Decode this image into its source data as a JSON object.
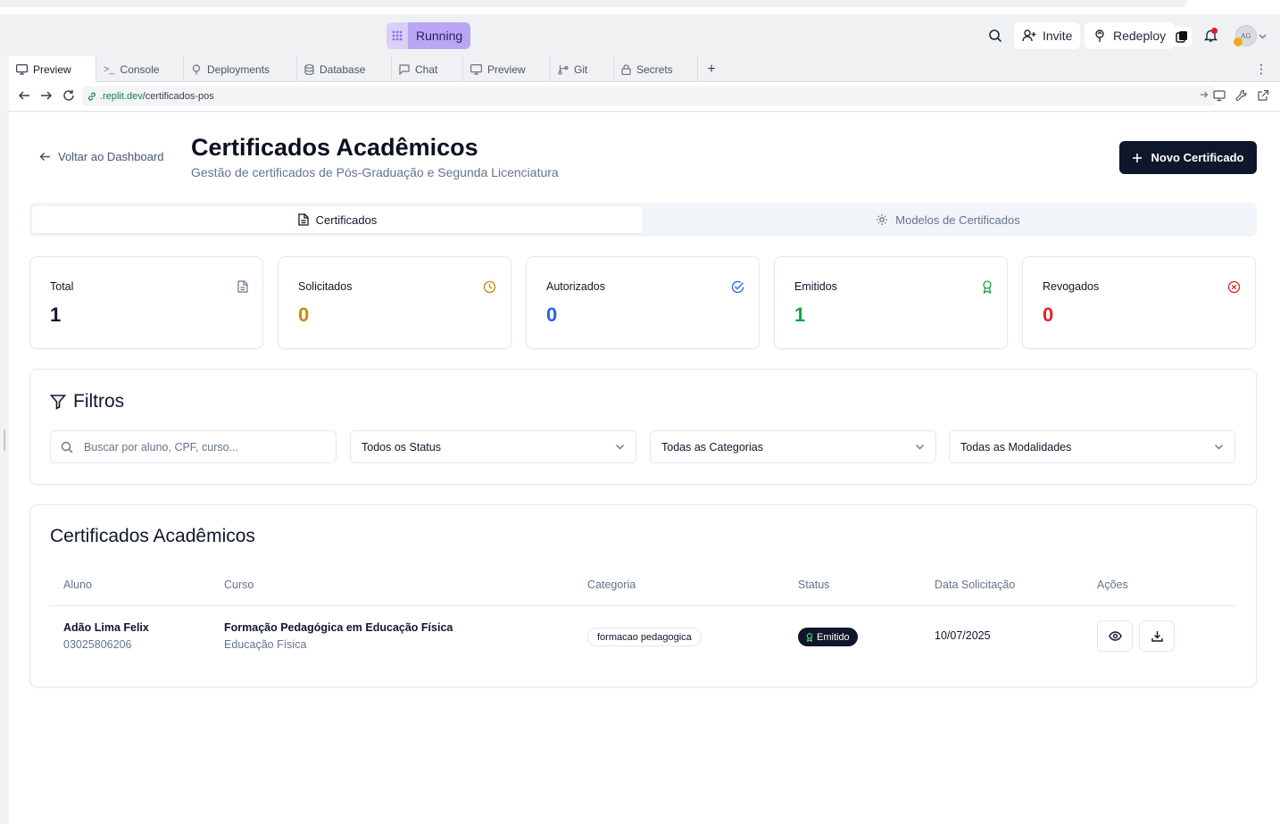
{
  "header": {
    "status": "Running",
    "invite_label": "Invite",
    "redeploy_label": "Redeploy",
    "avatar_initials": "AG"
  },
  "tabs": [
    {
      "label": "Preview",
      "icon": "monitor-icon"
    },
    {
      "label": "Console",
      "icon": "terminal-icon"
    },
    {
      "label": "Deployments",
      "icon": "deploy-icon"
    },
    {
      "label": "Database",
      "icon": "database-icon"
    },
    {
      "label": "Chat",
      "icon": "chat-icon"
    },
    {
      "label": "Preview",
      "icon": "monitor-icon"
    },
    {
      "label": "Git",
      "icon": "git-icon"
    },
    {
      "label": "Secrets",
      "icon": "lock-icon"
    }
  ],
  "url": {
    "domain": ".replit.dev",
    "path": "/certificados-pos"
  },
  "page": {
    "back_label": "Voltar ao Dashboard",
    "title": "Certificados Acadêmicos",
    "subtitle": "Gestão de certificados de Pós-Graduação e Segunda Licenciatura",
    "new_button": "Novo Certificado"
  },
  "segment": {
    "tab1": "Certificados",
    "tab2": "Modelos de Certificados"
  },
  "stats": [
    {
      "label": "Total",
      "value": "1",
      "color": "#0f172a",
      "icon": "document-icon"
    },
    {
      "label": "Solicitados",
      "value": "0",
      "color": "#ca8a04",
      "icon": "clock-icon"
    },
    {
      "label": "Autorizados",
      "value": "0",
      "color": "#2563eb",
      "icon": "check-circle-icon"
    },
    {
      "label": "Emitidos",
      "value": "1",
      "color": "#16a34a",
      "icon": "award-icon"
    },
    {
      "label": "Revogados",
      "value": "0",
      "color": "#dc2626",
      "icon": "x-circle-icon"
    }
  ],
  "filters": {
    "title": "Filtros",
    "search_placeholder": "Buscar por aluno, CPF, curso...",
    "status": "Todos os Status",
    "category": "Todas as Categorias",
    "modality": "Todas as Modalidades"
  },
  "table": {
    "title": "Certificados Acadêmicos",
    "headers": [
      "Aluno",
      "Curso",
      "Categoria",
      "Status",
      "Data Solicitação",
      "Ações"
    ],
    "rows": [
      {
        "student": "Adão Lima Felix",
        "cpf": "03025806206",
        "course": "Formação Pedagógica em Educação Física",
        "area": "Educação Física",
        "category": "formacao pedagogica",
        "status": "Emitido",
        "date": "10/07/2025"
      }
    ]
  }
}
